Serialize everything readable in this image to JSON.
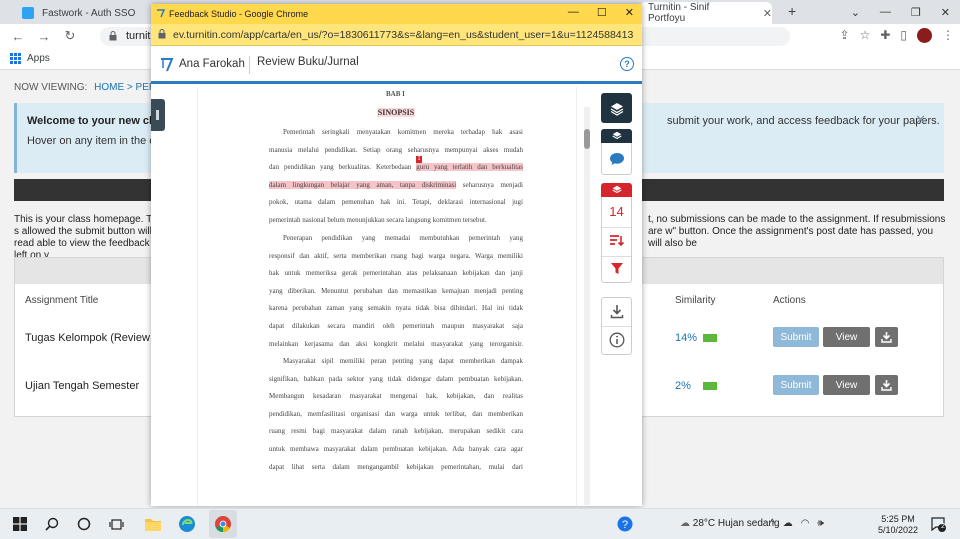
{
  "background_browser": {
    "tabs": [
      {
        "title": "Fastwork - Auth SSO"
      },
      {
        "title": "Turnitin - Sinif Portfoyu"
      }
    ],
    "url": "turnitin.com",
    "bookmarks": {
      "apps_label": "Apps"
    },
    "now_viewing_label": "NOW VIEWING:",
    "breadcrumb": "HOME > PERENCA",
    "info_title": "Welcome to your new class h",
    "info_text": "Hover on any item in the class l",
    "info_text_right": "submit your work, and access feedback for your papers.",
    "homepage_text_left": "This is your class homepage. To s allowed the submit button will read able to view the feedback left on y",
    "homepage_text_right": "t, no submissions can be made to the assignment. If resubmissions are w\" button. Once the assignment's post date has passed, you will also be",
    "table_headers": {
      "name": "Assignment Title",
      "similarity": "Similarity",
      "actions": "Actions"
    },
    "assignments": [
      {
        "title": "Tugas Kelompok (Review Buku",
        "similarity": "14%",
        "submit": "Submit",
        "view": "View"
      },
      {
        "title": "Ujian Tengah Semester",
        "similarity": "2%",
        "submit": "Submit",
        "view": "View"
      }
    ]
  },
  "popup": {
    "window_title": "Feedback Studio - Google Chrome",
    "url": "ev.turnitin.com/app/carta/en_us/?o=1830611773&s=&lang=en_us&student_user=1&u=1124588413",
    "user_name": "Ana Farokah",
    "doc_title": "Review Buku/Jurnal",
    "help_icon": "?",
    "match_count": "14",
    "mark_number": "1",
    "document": {
      "top_cut": "BAB I",
      "heading": "SINOPSIS",
      "paragraph1": [
        "Pemerintah seringkali menyatakan komitmen mereka terhadap hak asasi",
        "manusia melalui pendidikan. Setiap orang seharusnya mempunyai akses mudah",
        "dan pendidikan yang berkualitas. Keterbedaan",
        "guru yang terlatih dan berkualitas",
        "dalam lingkungan belajar yang aman, tanpa diskriminasi",
        "seharusnya menjadi",
        "pokok, utama dalam pemenuhan hak ini. Tetapi, deklarasi internasional jugi",
        "pemerintah nasional belum menunjukkan secara langsung komitmen tersebut."
      ],
      "paragraph2": [
        "Penerapan pendidikan yang memadai membutuhkan pemerintah yang",
        "responsif dan aktif, serta memberikan ruang bagi warga negara. Warga memiliki",
        "hak untuk memeriksa gerak pemerintahan atas pelaksanaan kebijakan dan janji",
        "yang diberikan. Menuntut perubahan dan memastikan kemajuan menjadi penting",
        "karena perubahan zaman yang semakin nyata tidak bisa dihindari. Hal ini tidak",
        "dapat dilakukan secara mandiri oleh pemerintah maupun masyarakat saja",
        "melainkan kerjasama dan aksi kongkrit melalui masyarakat yang terorganisir."
      ],
      "paragraph3": [
        "Masyarakat sipil memiliki peran penting yang dapat memberikan dampak",
        "signifikan, bahkan pada sektor yang tidak didengar dalam pembuatan kebijakan.",
        "Membangun kesadaran masyarakat mengenai hak, kebijakan, dan realitas",
        "pendidikan, memfasilitasi organisasi dan warga untuk terlibat, dan memberikan",
        "ruang resmi bagi masyarakat dalam ranah kebijakan, merupakan sedikit cara",
        "untuk membawa masyarakat dalam pembuatan kebijakan. Ada banyak cara agar",
        "dapat lihat serta dalam mengangambil kebijakan pemerintahan, mulai dari"
      ]
    }
  },
  "taskbar": {
    "weather": "28°C  Hujan sedang",
    "time": "5:25 PM",
    "date": "5/10/2022",
    "notifications": "2"
  },
  "colors": {
    "popup_title_bg": "#ffd84d",
    "turnitin_blue": "#2b7bbf",
    "match_red": "#d7262b",
    "highlight": "#f6c3c7",
    "similarity_green": "#5bb83a"
  }
}
